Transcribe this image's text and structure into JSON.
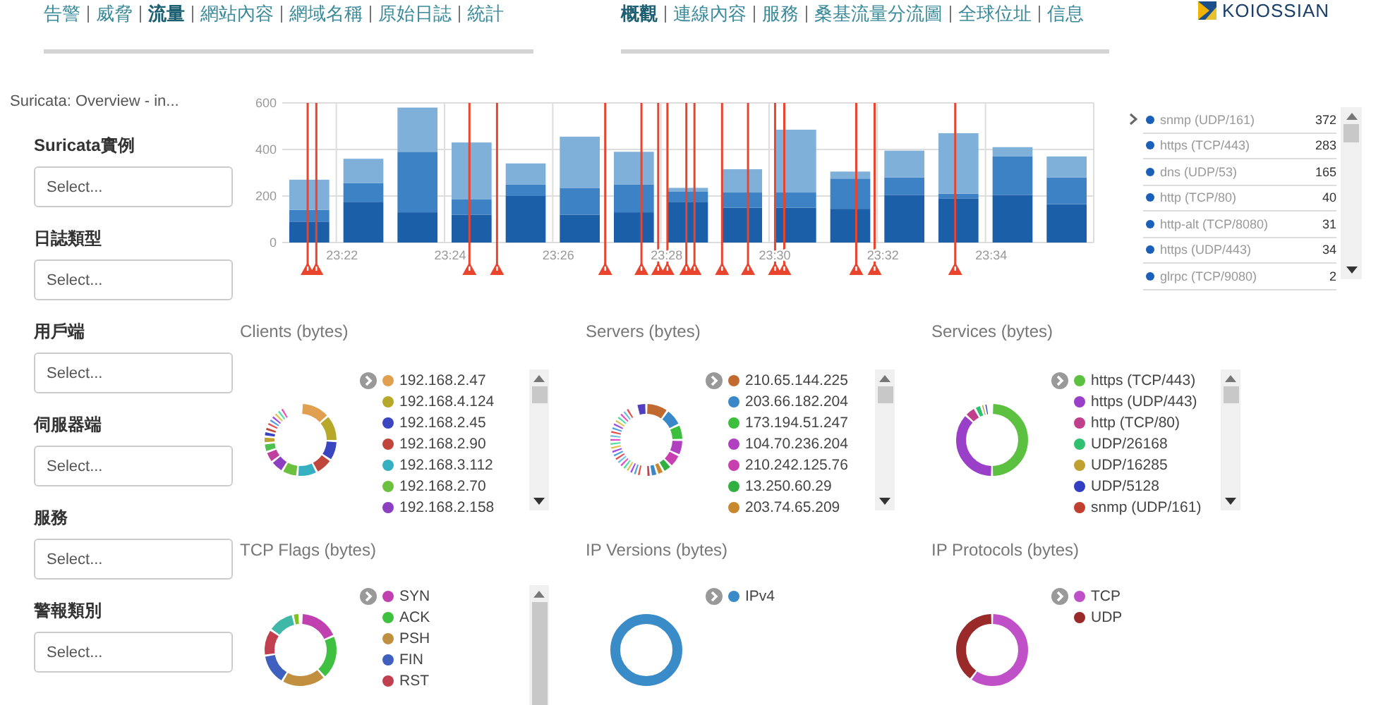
{
  "nav_left": [
    {
      "label": "告警",
      "selected": false
    },
    {
      "label": "威脅",
      "selected": false
    },
    {
      "label": "流量",
      "selected": true
    },
    {
      "label": "網站內容",
      "selected": false
    },
    {
      "label": "網域名稱",
      "selected": false
    },
    {
      "label": "原始日誌",
      "selected": false
    },
    {
      "label": "統計",
      "selected": false
    }
  ],
  "nav_right": [
    {
      "label": "概觀",
      "selected": true
    },
    {
      "label": "連線內容",
      "selected": false
    },
    {
      "label": "服務",
      "selected": false
    },
    {
      "label": "桑基流量分流圖",
      "selected": false
    },
    {
      "label": "全球位址",
      "selected": false
    },
    {
      "label": "信息",
      "selected": false
    }
  ],
  "logo": {
    "text": "KOIOSSIAN"
  },
  "sidebar": {
    "title": "Suricata: Overview - in...",
    "filters": [
      {
        "label": "Suricata實例",
        "placeholder": "Select..."
      },
      {
        "label": "日誌類型",
        "placeholder": "Select..."
      },
      {
        "label": "用戶端",
        "placeholder": "Select..."
      },
      {
        "label": "伺服器端",
        "placeholder": "Select..."
      },
      {
        "label": "服務",
        "placeholder": "Select..."
      },
      {
        "label": "警報類別",
        "placeholder": "Select..."
      }
    ]
  },
  "traffic_chart": {
    "chart_data": {
      "type": "bar",
      "stacked": true,
      "grid": true,
      "categories": [
        null,
        "23:22",
        null,
        "23:24",
        null,
        "23:26",
        null,
        "23:28",
        null,
        "23:30",
        null,
        "23:32",
        null,
        "23:34",
        null
      ],
      "series": [
        {
          "color": "#1a5fa8",
          "values": [
            90,
            175,
            130,
            120,
            200,
            120,
            130,
            175,
            150,
            150,
            145,
            205,
            190,
            205,
            165
          ]
        },
        {
          "color": "#3c82c4",
          "values": [
            50,
            80,
            260,
            65,
            50,
            115,
            120,
            45,
            65,
            65,
            130,
            75,
            20,
            165,
            115
          ]
        },
        {
          "color": "#7fb0da",
          "values": [
            130,
            105,
            190,
            245,
            90,
            220,
            140,
            15,
            100,
            270,
            30,
            115,
            260,
            40,
            90
          ]
        }
      ],
      "ylim": [
        0,
        600
      ],
      "yticks": [
        0,
        200,
        400,
        600
      ]
    }
  },
  "service_list": {
    "items": [
      {
        "name": "snmp (UDP/161)",
        "value": "372"
      },
      {
        "name": "https (TCP/443)",
        "value": "283"
      },
      {
        "name": "dns (UDP/53)",
        "value": "165"
      },
      {
        "name": "http (TCP/80)",
        "value": "40"
      },
      {
        "name": "http-alt (TCP/8080)",
        "value": "31"
      },
      {
        "name": "https (UDP/443)",
        "value": "34"
      },
      {
        "name": "glrpc (TCP/9080)",
        "value": "2"
      }
    ]
  },
  "panels": [
    {
      "title": "Clients (bytes)",
      "legend": [
        {
          "label": "192.168.2.47",
          "color": "#e0a050"
        },
        {
          "label": "192.168.4.124",
          "color": "#b8a82a"
        },
        {
          "label": "192.168.2.45",
          "color": "#3a45c0"
        },
        {
          "label": "192.168.2.90",
          "color": "#c0453a"
        },
        {
          "label": "192.168.3.112",
          "color": "#35b0c0"
        },
        {
          "label": "192.168.2.70",
          "color": "#6cc040"
        },
        {
          "label": "192.168.2.158",
          "color": "#8c40c0"
        }
      ]
    },
    {
      "title": "Servers (bytes)",
      "legend": [
        {
          "label": "210.65.144.225",
          "color": "#c06a30"
        },
        {
          "label": "203.66.182.204",
          "color": "#3a88c8"
        },
        {
          "label": "173.194.51.247",
          "color": "#3cbf3c"
        },
        {
          "label": "104.70.236.204",
          "color": "#b040c0"
        },
        {
          "label": "210.242.125.76",
          "color": "#c840b0"
        },
        {
          "label": "13.250.60.29",
          "color": "#30b040"
        },
        {
          "label": "203.74.65.209",
          "color": "#c88830"
        }
      ]
    },
    {
      "title": "Services (bytes)",
      "legend": [
        {
          "label": "https (TCP/443)",
          "color": "#5cc040"
        },
        {
          "label": "https (UDP/443)",
          "color": "#9a40c8"
        },
        {
          "label": "http (TCP/80)",
          "color": "#c0408c"
        },
        {
          "label": "UDP/26168",
          "color": "#30c070"
        },
        {
          "label": "UDP/16285",
          "color": "#c0a030"
        },
        {
          "label": "UDP/5128",
          "color": "#3040c0"
        },
        {
          "label": "snmp (UDP/161)",
          "color": "#c04030"
        }
      ]
    },
    {
      "title": "TCP Flags (bytes)",
      "legend": [
        {
          "label": "SYN",
          "color": "#c040b0"
        },
        {
          "label": "ACK",
          "color": "#40c040"
        },
        {
          "label": "PSH",
          "color": "#c09040"
        },
        {
          "label": "FIN",
          "color": "#4060c0"
        },
        {
          "label": "RST",
          "color": "#c04050"
        }
      ]
    },
    {
      "title": "IP Versions (bytes)",
      "legend": [
        {
          "label": "IPv4",
          "color": "#3a8cc8"
        }
      ]
    },
    {
      "title": "IP Protocols (bytes)",
      "legend": [
        {
          "label": "TCP",
          "color": "#c050c8"
        },
        {
          "label": "UDP",
          "color": "#9a2a2a"
        }
      ]
    }
  ]
}
